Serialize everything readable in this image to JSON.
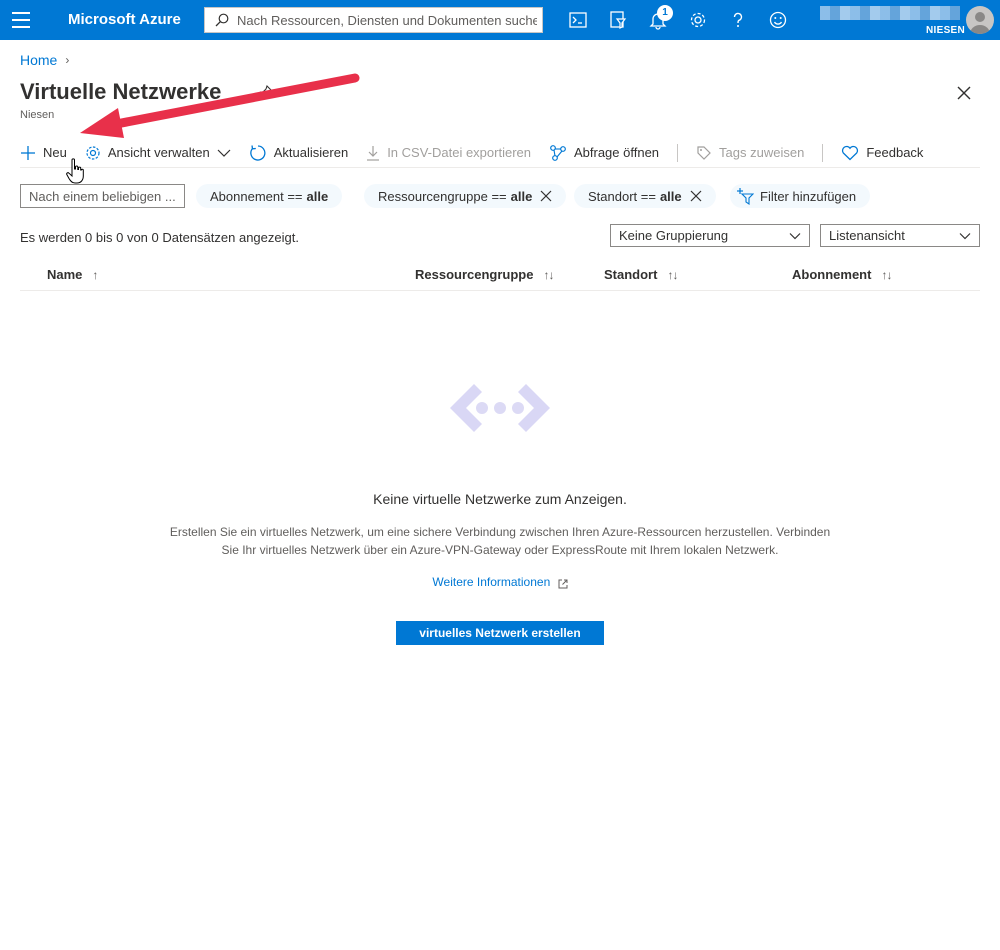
{
  "header": {
    "brand": "Microsoft Azure",
    "search_placeholder": "Nach Ressourcen, Diensten und Dokumenten suchen",
    "notification_count": "1",
    "account_name": "NIESEN",
    "icons": [
      "cloud-shell-icon",
      "directory-filter-icon",
      "notifications-icon",
      "settings-icon",
      "help-icon",
      "feedback-smiley-icon"
    ]
  },
  "breadcrumb": {
    "home": "Home"
  },
  "page": {
    "title": "Virtuelle Netzwerke",
    "subtitle": "Niesen"
  },
  "toolbar": {
    "new": "Neu",
    "manage_view": "Ansicht verwalten",
    "refresh": "Aktualisieren",
    "export_csv": "In CSV-Datei exportieren",
    "open_query": "Abfrage öffnen",
    "assign_tags": "Tags zuweisen",
    "feedback": "Feedback"
  },
  "filters": {
    "search_placeholder": "Nach einem beliebigen ...",
    "subscription_label": "Abonnement ==",
    "subscription_value": "alle",
    "resource_group_label": "Ressourcengruppe ==",
    "resource_group_value": "alle",
    "location_label": "Standort ==",
    "location_value": "alle",
    "add_filter": "Filter hinzufügen"
  },
  "list": {
    "count_text": "Es werden 0 bis 0 von 0 Datensätzen angezeigt.",
    "grouping": "Keine Gruppierung",
    "view": "Listenansicht",
    "columns": [
      "Name",
      "Ressourcengruppe",
      "Standort",
      "Abonnement"
    ]
  },
  "empty_state": {
    "title": "Keine virtuelle Netzwerke zum Anzeigen.",
    "description": "Erstellen Sie ein virtuelles Netzwerk, um eine sichere Verbindung zwischen Ihren Azure-Ressourcen herzustellen. Verbinden Sie Ihr virtuelles Netzwerk über ein Azure-VPN-Gateway oder ExpressRoute mit Ihrem lokalen Netzwerk.",
    "learn_more": "Weitere Informationen",
    "create_button": "virtuelles Netzwerk erstellen"
  },
  "colors": {
    "accent": "#0078d4",
    "annotation_arrow": "#e8304a"
  }
}
